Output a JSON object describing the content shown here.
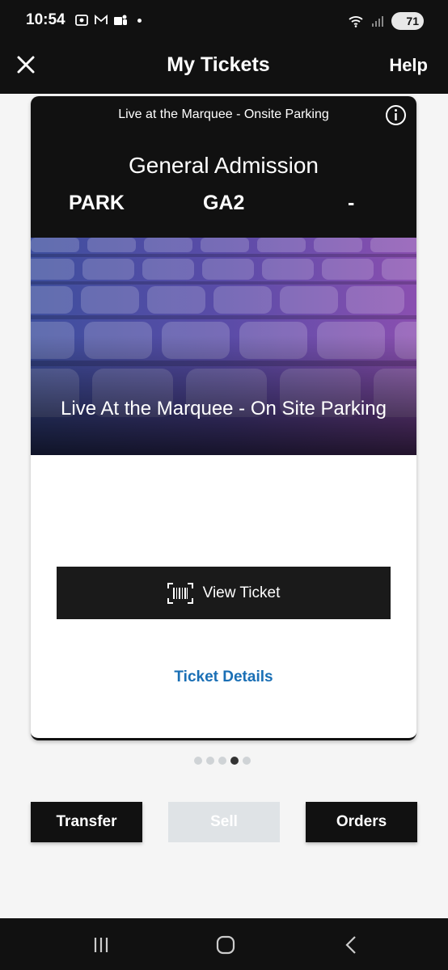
{
  "status_bar": {
    "time": "10:54",
    "battery": "71",
    "icons": [
      "screenshot-icon",
      "gmail-icon",
      "teams-icon",
      "notification-dot",
      "wifi-icon",
      "signal-icon",
      "battery-icon"
    ]
  },
  "header": {
    "title": "My Tickets",
    "help": "Help",
    "close_icon": "close-icon"
  },
  "ticket": {
    "event_name": "Live at the Marquee - Onsite Parking",
    "admission": "General Admission",
    "section": "PARK",
    "row": "GA2",
    "seat": "-",
    "hero_title": "Live At the Marquee - On Site Parking",
    "view_ticket_label": "View Ticket",
    "ticket_details_label": "Ticket Details"
  },
  "pager": {
    "count": 5,
    "active": 4
  },
  "actions": {
    "transfer": "Transfer",
    "sell": "Sell",
    "orders": "Orders"
  },
  "colors": {
    "header_bg": "#111111",
    "link": "#1a6fb5",
    "disabled": "#dfe3e6"
  },
  "nav": {
    "icons": [
      "recent-apps-icon",
      "home-icon",
      "back-icon"
    ]
  }
}
